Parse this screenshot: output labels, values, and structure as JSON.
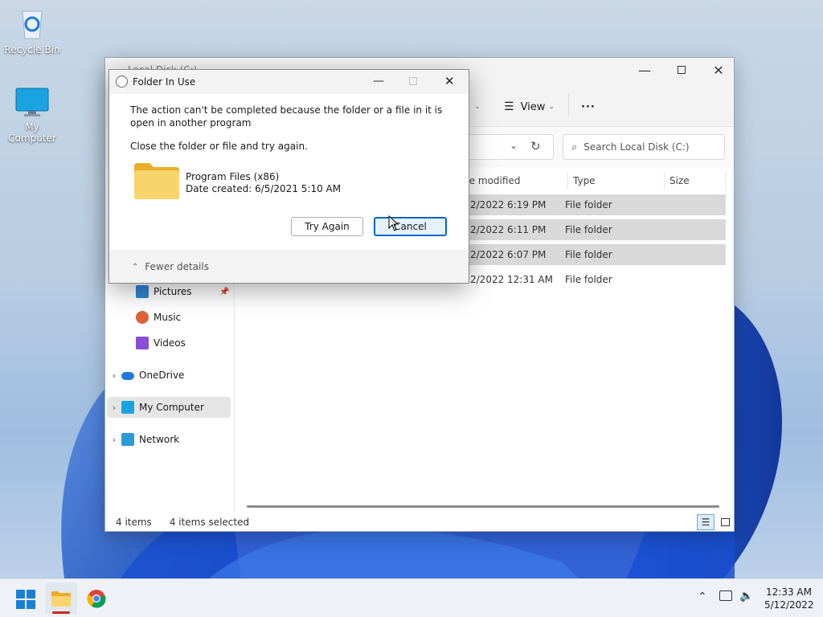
{
  "desktop": {
    "icons": [
      {
        "label": "Recycle Bin",
        "icon": "recycle-bin-icon"
      },
      {
        "label": "My Computer",
        "icon": "monitor-icon"
      }
    ]
  },
  "explorer": {
    "title": "Local Disk (C:)",
    "toolbar": {
      "view_label": "View",
      "more_label": "···",
      "sort_fragment": "t"
    },
    "search_placeholder": "Search Local Disk (C:)",
    "columns": {
      "date": "te modified",
      "type": "Type",
      "size": "Size"
    },
    "rows": [
      {
        "date": "2/2022 6:19 PM",
        "type": "File folder",
        "selected": true
      },
      {
        "date": "2/2022 6:11 PM",
        "type": "File folder",
        "selected": true
      },
      {
        "date": "2/2022 6:07 PM",
        "type": "File folder",
        "selected": true
      },
      {
        "date": "2/2022 12:31 AM",
        "type": "File folder",
        "selected": false
      }
    ],
    "nav": {
      "pictures": "Pictures",
      "music": "Music",
      "videos": "Videos",
      "onedrive": "OneDrive",
      "my_computer": "My Computer",
      "network": "Network"
    },
    "status": {
      "items": "4 items",
      "selected": "4 items selected"
    }
  },
  "dialog": {
    "title": "Folder In Use",
    "message": "The action can't be completed because the folder or a file in it is open in another program",
    "instruction": "Close the folder or file and try again.",
    "item_name": "Program Files (x86)",
    "item_date": "Date created: 6/5/2021 5:10 AM",
    "try_again": "Try Again",
    "cancel": "Cancel",
    "fewer_details": "Fewer details"
  },
  "taskbar": {
    "time": "12:33 AM",
    "date": "5/12/2022"
  },
  "colors": {
    "accent": "#0067c0",
    "folder": "#f8c945"
  }
}
